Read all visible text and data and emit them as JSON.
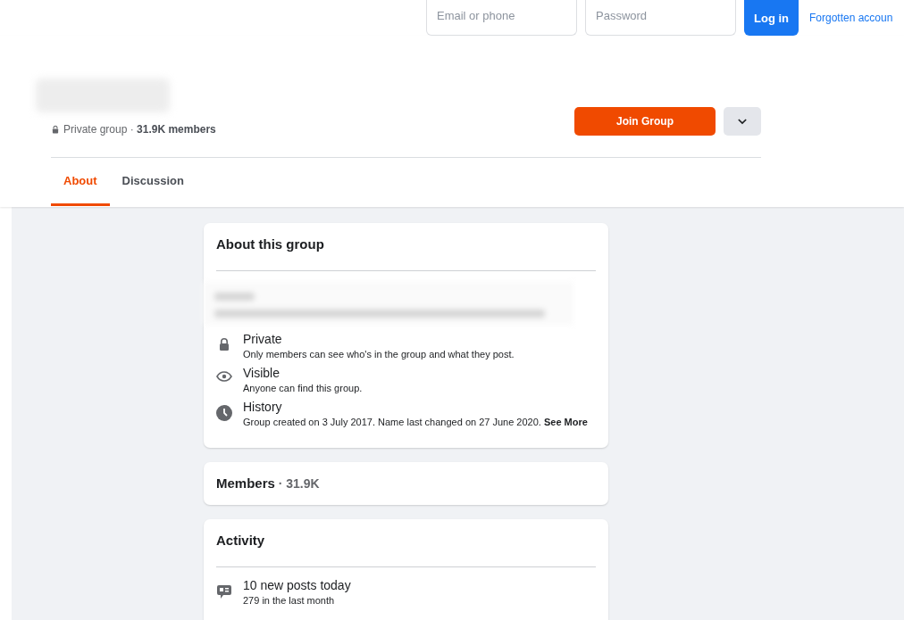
{
  "login_bar": {
    "email": {
      "placeholder": "Email or phone"
    },
    "password": {
      "placeholder": "Password"
    },
    "login_button": "Log in",
    "forgot_link": "Forgotten accoun"
  },
  "group_header": {
    "privacy_meta": "Private group · **31.9K members**",
    "join_button": "Join Group"
  },
  "tabs": [
    {
      "label": "About",
      "selected": true
    },
    {
      "label": "Discussion",
      "selected": false
    }
  ],
  "about_card": {
    "title": "About this group",
    "items": [
      {
        "kind": "lock",
        "title": "Private",
        "text": "Only members can see who's in the group and what they post."
      },
      {
        "kind": "eye",
        "title": "Visible",
        "text": "Anyone can find this group."
      },
      {
        "kind": "clock",
        "title": "History",
        "text": "Group created on 3 July 2017. Name last changed on 27 June 2020.",
        "link": "See More"
      }
    ]
  },
  "members_card": {
    "title": "Members",
    "count": " · 31.9K"
  },
  "activity_card": {
    "title": "Activity",
    "items": [
      {
        "kind": "posts",
        "title": "10 new posts today",
        "text": "279 in the last month"
      }
    ]
  }
}
